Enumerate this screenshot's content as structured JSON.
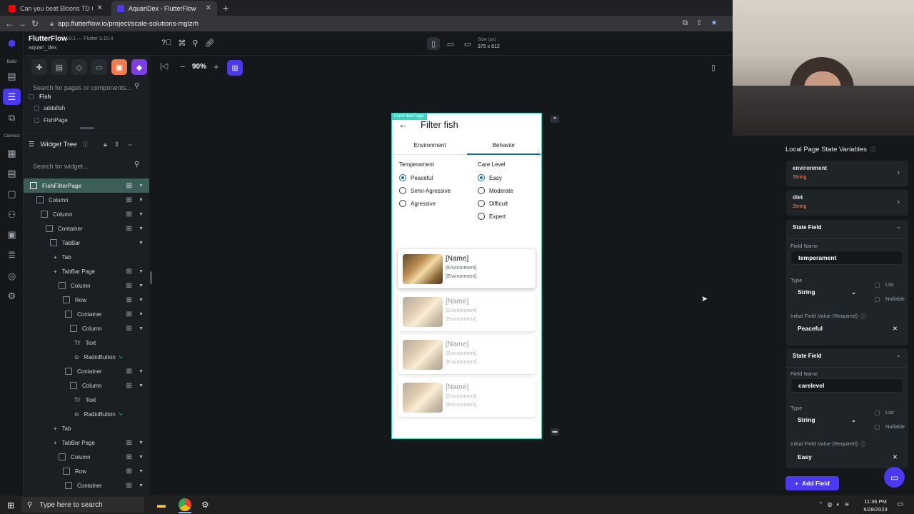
{
  "browser": {
    "tabs": [
      {
        "title": "Can you beat Bloons TD 6 with C",
        "active": false
      },
      {
        "title": "AquariDex - FlutterFlow",
        "active": true
      }
    ],
    "url": "app.flutterflow.io/project/scale-solutions-mglzrh"
  },
  "app": {
    "name": "FlutterFlow",
    "version": "v3.1 — Flutter 3.10.4",
    "project": "aquari_dex"
  },
  "rail": {
    "build_label": "Build",
    "connect_label": "Connect"
  },
  "device": {
    "size_label": "Size (px)",
    "size_value": "375 x 812"
  },
  "left": {
    "page_search_placeholder": "Search for pages or components...",
    "pages_folder": "Fish",
    "pages": [
      "addafish",
      "FishPage"
    ],
    "widget_tree_title": "Widget Tree",
    "widget_search_placeholder": "Search for widget...",
    "tree": [
      "FishFilterPage",
      "Column",
      "Column",
      "Container",
      "TabBar",
      "Tab",
      "TabBar Page",
      "Column",
      "Row",
      "Container",
      "Column",
      "Text",
      "RadioButton",
      "Container",
      "Column",
      "Text",
      "RadioButton",
      "Tab",
      "TabBar Page",
      "Column",
      "Row",
      "Container"
    ]
  },
  "canvas": {
    "zoom": "90%",
    "page_badge": "FishFilterPage",
    "title": "Filter fish",
    "tabs": [
      "Environment",
      "Behavior"
    ],
    "temperament_label": "Temperament",
    "temperament_options": [
      "Peaceful",
      "Semi-Agressive",
      "Agressive"
    ],
    "care_label": "Care Level",
    "care_options": [
      "Easy",
      "Moderate",
      "Difficult",
      "Expert"
    ],
    "card_name": "[Name]",
    "card_env": "[Environment]"
  },
  "right": {
    "title": "Local Page State Variables",
    "vars": [
      {
        "name": "environment",
        "type": "String"
      },
      {
        "name": "diet",
        "type": "String"
      }
    ],
    "state_field_label": "State Field",
    "field_name_label": "Field Name",
    "type_label": "Type",
    "list_label": "List",
    "nullable_label": "Nullable",
    "initial_label": "Initial Field Value (Required)",
    "fields": [
      {
        "name": "temperament",
        "type": "String",
        "initial": "Peaceful"
      },
      {
        "name": "carelevel",
        "type": "String",
        "initial": "Easy"
      }
    ],
    "add_field": "Add Field"
  },
  "taskbar": {
    "search_placeholder": "Type here to search",
    "time": "11:36 PM",
    "date": "6/28/2023"
  },
  "colors": {
    "accent": "#39d2c0",
    "primary": "#4b39ef",
    "selected_tree": "#3b5f58",
    "radio": "#0e6fb5",
    "string_type": "#ee8b60"
  }
}
